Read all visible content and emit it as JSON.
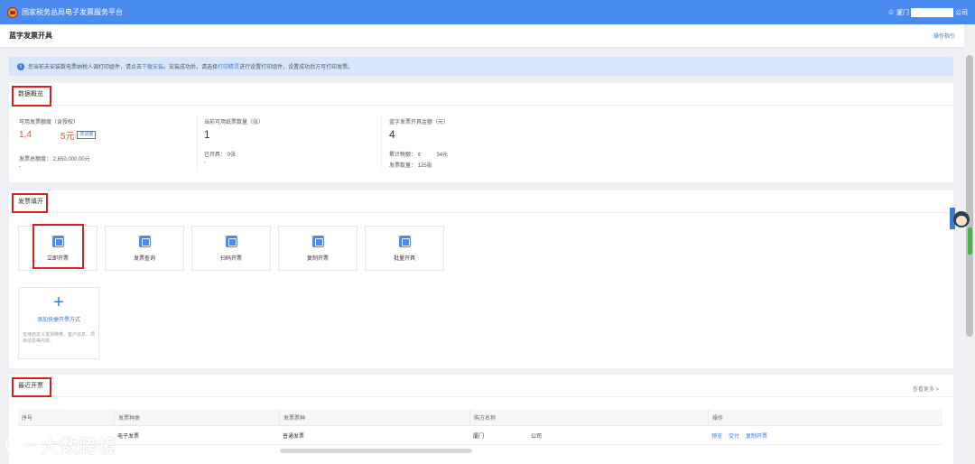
{
  "header": {
    "title": "国家税务总局电子发票服务平台",
    "user_prefix": "厦门",
    "user_suffix": "公司"
  },
  "page": {
    "title": "蓝字发票开具",
    "guide_link": "操作指引"
  },
  "notice": {
    "text_1": "您当前未安装数电票纳税人调打印组件，请点击",
    "link_1": "下载安装",
    "text_2": "。安装成功后，请选择",
    "link_2": "打印精灵",
    "text_3": "进行设置打印组件，设置成功后方可打印发票。"
  },
  "overview": {
    "title": "数据概览",
    "col1": {
      "label": "可用发票额度（含授权）",
      "value_start": "1,4",
      "value_end": "5元",
      "tag": "去调整",
      "sub": "发票总额度： 2,650,000.00元",
      "dash": "-"
    },
    "col2": {
      "label": "当前可用纸票数量（张）",
      "value": "1",
      "sub": "已开具： 0张",
      "dash": "-"
    },
    "col3": {
      "label": "蓝字发票开具金额（元）",
      "value": "4",
      "tax": "累计税额： ¢",
      "tax_end": "34元",
      "count": "发票数量： 125张"
    }
  },
  "issue": {
    "title": "发票填开",
    "tiles": [
      {
        "label": "立即开票"
      },
      {
        "label": "发票查询"
      },
      {
        "label": "扫码开票"
      },
      {
        "label": "复制开票"
      },
      {
        "label": "批量开具"
      }
    ],
    "add": {
      "label": "添加快捷开票方式",
      "desc": "支持自定义发票种类、客户信息、项目信息等内容。"
    }
  },
  "recent": {
    "title": "最近开票",
    "more": "查看更多 >",
    "columns": [
      "序号",
      "发票种类",
      "发票票种",
      "购方名称",
      "操作"
    ],
    "rows": [
      {
        "type": "电子发票",
        "kind": "普通发票",
        "buyer": "厦门",
        "buyer_end": "公司",
        "actions": [
          "预览",
          "交付",
          "复制开票"
        ]
      }
    ]
  },
  "watermark": {
    "text": "大数跨境"
  },
  "colors": {
    "header_bg": "#4a8bf0",
    "accent": "#3a7bd5",
    "highlight": "#d9201c",
    "amount_red": "#e5502e"
  }
}
